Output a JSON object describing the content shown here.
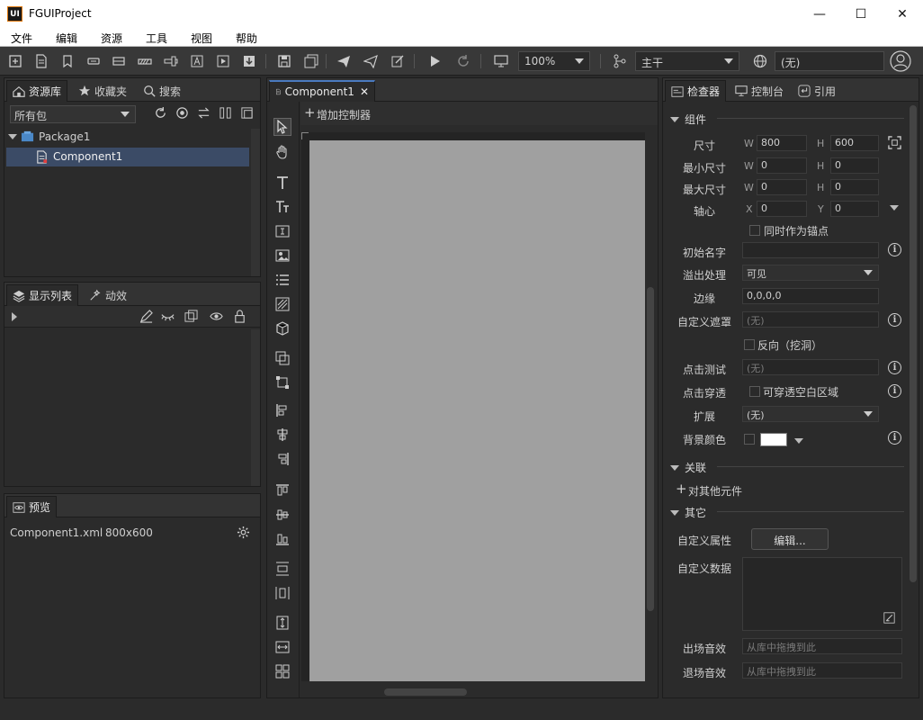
{
  "app": {
    "logo": "UI",
    "title": "FGUIProject"
  },
  "window": {
    "minimize": "—",
    "maximize": "☐",
    "close": "✕"
  },
  "menu": [
    "文件",
    "编辑",
    "资源",
    "工具",
    "视图",
    "帮助"
  ],
  "toolbar": {
    "zoom": "100%",
    "branch": "主干",
    "language": "(无)"
  },
  "left": {
    "tabs": [
      "资源库",
      "收藏夹",
      "搜索"
    ],
    "package_filter": "所有包",
    "tree": {
      "package": "Package1",
      "component": "Component1"
    },
    "display_tabs": [
      "显示列表",
      "动效"
    ],
    "preview_tab": "预览",
    "preview_file": "Component1.xml",
    "preview_size": "800x600"
  },
  "center": {
    "doc_tab": "Component1",
    "add_controller": "增加控制器"
  },
  "inspector": {
    "tabs": [
      "检查器",
      "控制台",
      "引用"
    ],
    "section_component": "组件",
    "size_label": "尺寸",
    "w_prefix": "W",
    "h_prefix": "H",
    "size_w": "800",
    "size_h": "600",
    "min_label": "最小尺寸",
    "min_w": "0",
    "min_h": "0",
    "max_label": "最大尺寸",
    "max_w": "0",
    "max_h": "0",
    "pivot_label": "轴心",
    "x_prefix": "X",
    "y_prefix": "Y",
    "pivot_x": "0",
    "pivot_y": "0",
    "anchor_label": "同时作为锚点",
    "initname_label": "初始名字",
    "overflow_label": "溢出处理",
    "overflow_value": "可见",
    "margin_label": "边缘",
    "margin_value": "0,0,0,0",
    "mask_label": "自定义遮罩",
    "mask_value": "(无)",
    "reverse_label": "反向（挖洞）",
    "hittest_label": "点击测试",
    "hittest_value": "(无)",
    "clickthrough_label": "点击穿透",
    "clickthrough_value": "可穿透空白区域",
    "extend_label": "扩展",
    "extend_value": "(无)",
    "bgcolor_label": "背景颜色",
    "bgcolor": "#ffffff",
    "section_relation": "关联",
    "relation_add": "对其他元件",
    "section_other": "其它",
    "custom_props_label": "自定义属性",
    "custom_props_button": "编辑...",
    "custom_data_label": "自定义数据",
    "enter_sound_label": "出场音效",
    "enter_sound_value": "从库中拖拽到此",
    "exit_sound_label": "退场音效",
    "exit_sound_value": "从库中拖拽到此"
  },
  "colors": {
    "canvas": "#a0a0a0",
    "accent": "#3a5a8a",
    "selection": "#3b4b66"
  }
}
